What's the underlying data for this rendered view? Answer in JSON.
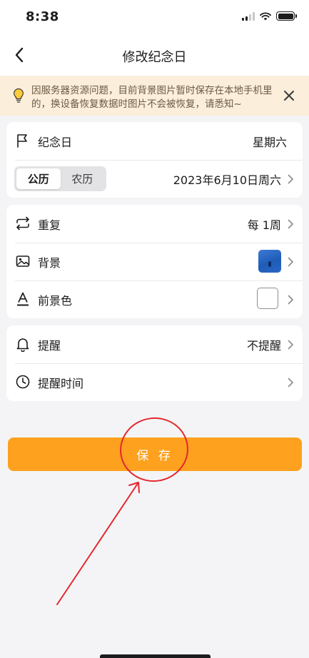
{
  "status_bar": {
    "time": "8:38"
  },
  "nav": {
    "title": "修改纪念日"
  },
  "notice": {
    "text": "因服务器资源问题，目前背景图片暂时保存在本地手机里的，换设备恢复数据时图片不会被恢复，请悉知~"
  },
  "date_card": {
    "event_label": "纪念日",
    "event_value": "星期六",
    "calendar_tabs": [
      "公历",
      "农历"
    ],
    "selected_tab": "公历",
    "date_value": "2023年6月10日周六"
  },
  "style_card": {
    "repeat_label": "重复",
    "repeat_value": "每 1周",
    "background_label": "背景",
    "foreground_label": "前景色"
  },
  "reminder_card": {
    "reminder_label": "提醒",
    "reminder_value": "不提醒",
    "reminder_time_label": "提醒时间"
  },
  "save_button": {
    "label": "保 存"
  },
  "colors": {
    "accent": "#fda11e",
    "notice_bg": "#fbeedb",
    "annotation": "#e3272d",
    "page_bg": "#f4f4f6"
  }
}
